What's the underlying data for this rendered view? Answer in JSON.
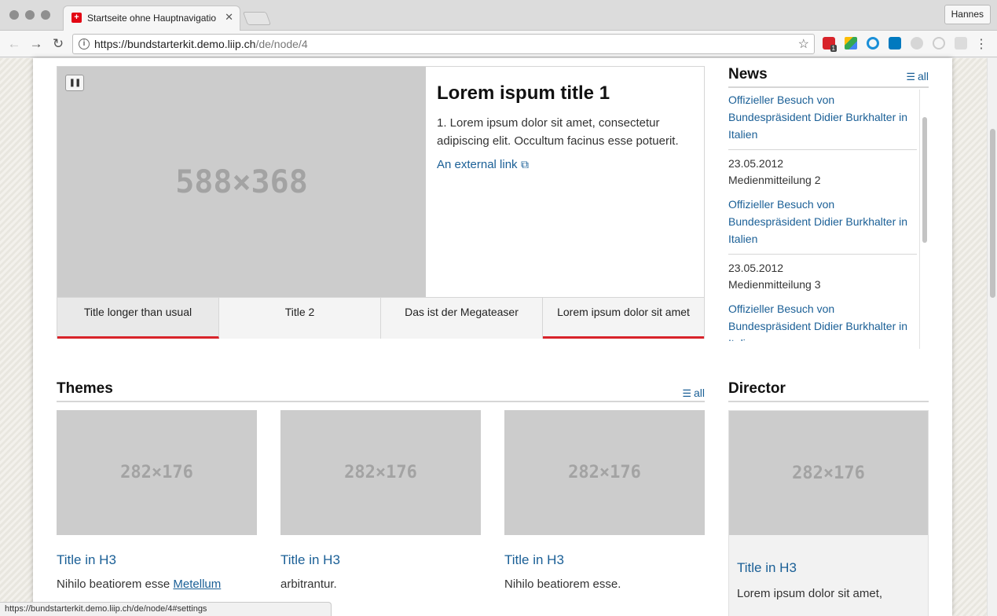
{
  "browser": {
    "tab_title": "Startseite ohne Hauptnavigatio",
    "tab_close": "✕",
    "profile": "Hannes",
    "url_host": "https://bundstarterkit.demo.liip.ch",
    "url_path": "/de/node/4",
    "ext_badge": "1"
  },
  "carousel": {
    "image_label": "588×368",
    "title": "Lorem ispum title 1",
    "description": "1. Lorem ipsum dolor sit amet, consectetur adipiscing elit. Occultum facinus esse potuerit.",
    "link_text": "An external link",
    "tabs": [
      "Title longer than usual",
      "Title 2",
      "Das ist der Megateaser",
      "Lorem ipsum dolor sit amet"
    ]
  },
  "news": {
    "title": "News",
    "all_label": "all",
    "items": [
      {
        "date": "",
        "subtitle": "",
        "link": "Offizieller Besuch von Bundespräsident Didier Burkhalter in Italien"
      },
      {
        "date": "23.05.2012",
        "subtitle": "Medienmitteilung 2",
        "link": "Offizieller Besuch von Bundespräsident Didier Burkhalter in Italien"
      },
      {
        "date": "23.05.2012",
        "subtitle": "Medienmitteilung 3",
        "link": "Offizieller Besuch von Bundespräsident Didier Burkhalter in Italien"
      }
    ]
  },
  "themes": {
    "title": "Themes",
    "all_label": "all",
    "cards": [
      {
        "image_label": "282×176",
        "title": "Title in H3",
        "text": "Nihilo beatiorem esse ",
        "link": "Metellum"
      },
      {
        "image_label": "282×176",
        "title": "Title in H3",
        "text": "arbitrantur.",
        "link": ""
      },
      {
        "image_label": "282×176",
        "title": "Title in H3",
        "text": "Nihilo beatiorem esse.",
        "link": ""
      }
    ]
  },
  "director": {
    "title": "Director",
    "image_label": "282×176",
    "card_title": "Title in H3",
    "card_text": "Lorem ipsum dolor sit amet,"
  },
  "status_url": "https://bundstarterkit.demo.liip.ch/de/node/4#settings",
  "colors": {
    "accent": "#d8232a",
    "link": "#1a5f96"
  }
}
